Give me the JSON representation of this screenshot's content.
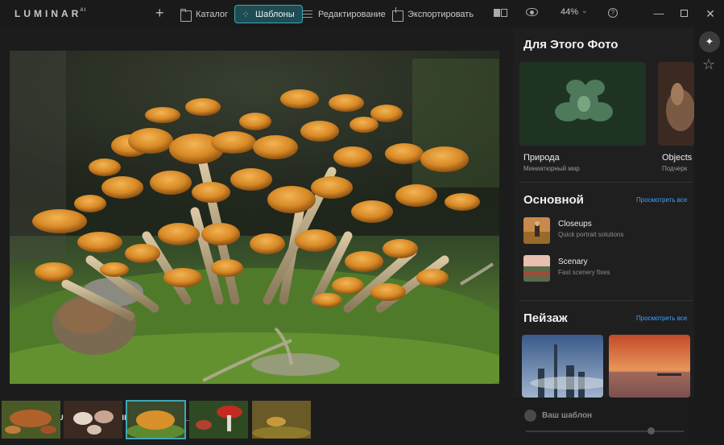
{
  "app": {
    "logo": "LUMINAR",
    "logo_version": "AI"
  },
  "toolbar": {
    "add": "+",
    "catalog": "Каталог",
    "templates": "Шаблоны",
    "edit": "Редактирование",
    "export": "Экспортировать",
    "zoom": "44%",
    "zoom_chevron": "⌄",
    "help": "?"
  },
  "window": {
    "minimize": "—",
    "close": "✕"
  },
  "photo": {
    "filename": "NATURE__MUSHROOMS_FAMILY_EXPERIENCE_041938_.JPG",
    "close": "✕",
    "favorite": "♡"
  },
  "filmstrip": {
    "count": 5,
    "selected_index": 2
  },
  "panel": {
    "for_this_photo": {
      "title": "Для Этого Фото",
      "cards": [
        {
          "title": "Природа",
          "subtitle": "Миниатюрный мир"
        },
        {
          "title": "Objects",
          "subtitle": "Подчерк"
        }
      ]
    },
    "basic": {
      "title": "Основной",
      "see_all": "Просмотреть все",
      "items": [
        {
          "title": "Closeups",
          "subtitle": "Quick portrait solutions"
        },
        {
          "title": "Scenary",
          "subtitle": "Fast scenery fixes"
        }
      ]
    },
    "landscape": {
      "title": "Пейзаж",
      "see_all": "Просмотреть все"
    },
    "user_template": {
      "label": "Ваш шаблон"
    }
  },
  "sidebar": {
    "templates_icon": "✦",
    "favorites_icon": "☆"
  },
  "colors": {
    "accent": "#3ea7b4",
    "link": "#3aa3ff",
    "background": "#1c1c1d"
  }
}
